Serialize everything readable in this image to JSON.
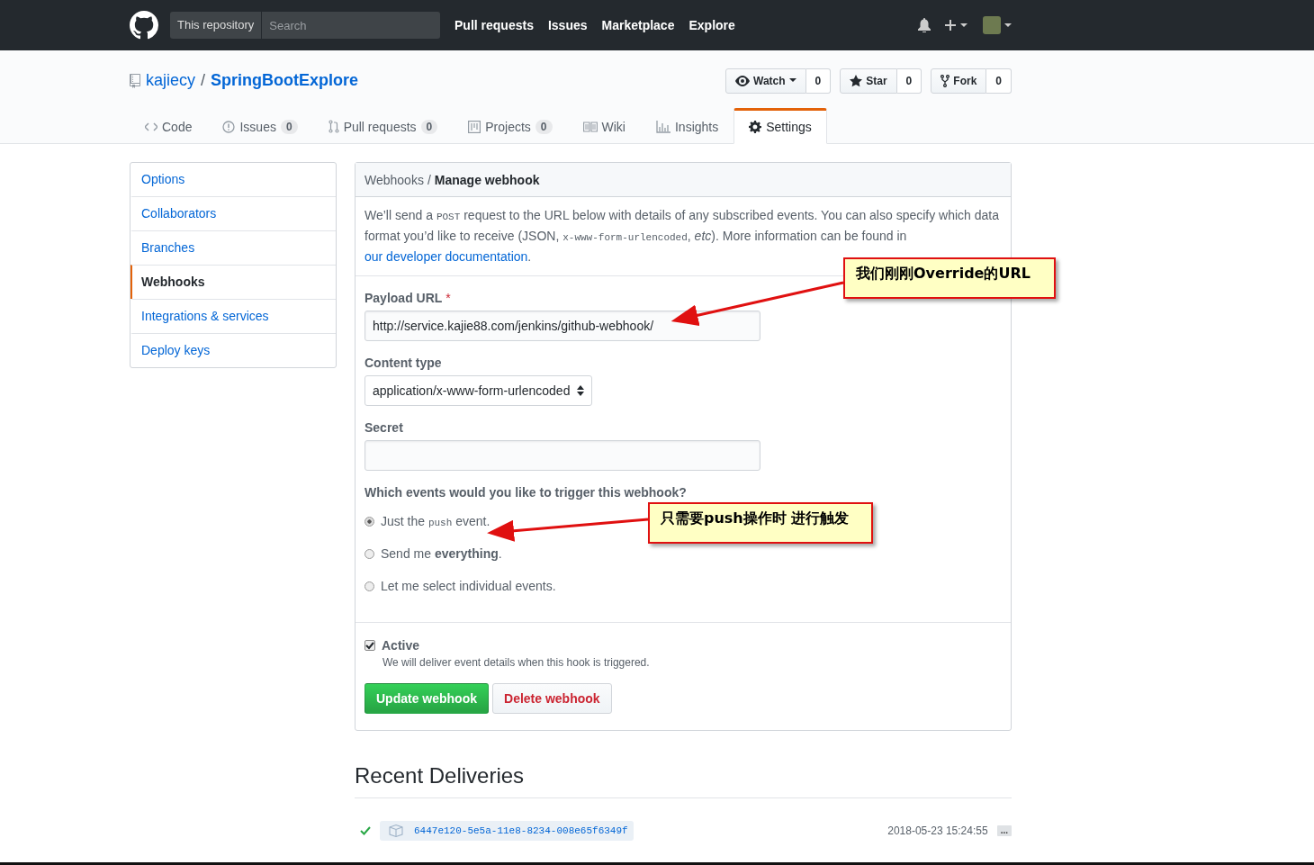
{
  "header": {
    "scope": "This repository",
    "search_placeholder": "Search",
    "nav": [
      "Pull requests",
      "Issues",
      "Marketplace",
      "Explore"
    ]
  },
  "repo": {
    "owner": "kajiecy",
    "separator": "/",
    "name": "SpringBootExplore"
  },
  "repo_actions": [
    {
      "kind": "watch",
      "label": "Watch",
      "count": "0"
    },
    {
      "kind": "star",
      "label": "Star",
      "count": "0"
    },
    {
      "kind": "fork",
      "label": "Fork",
      "count": "0"
    }
  ],
  "tabs": [
    {
      "kind": "code",
      "label": "Code",
      "selected": false
    },
    {
      "kind": "issues",
      "label": "Issues",
      "count": "0",
      "selected": false
    },
    {
      "kind": "pulls",
      "label": "Pull requests",
      "count": "0",
      "selected": false
    },
    {
      "kind": "projects",
      "label": "Projects",
      "count": "0",
      "selected": false
    },
    {
      "kind": "wiki",
      "label": "Wiki",
      "selected": false
    },
    {
      "kind": "insights",
      "label": "Insights",
      "selected": false
    },
    {
      "kind": "settings",
      "label": "Settings",
      "selected": true
    }
  ],
  "sidebar": {
    "items": [
      {
        "label": "Options",
        "selected": false
      },
      {
        "label": "Collaborators",
        "selected": false
      },
      {
        "label": "Branches",
        "selected": false
      },
      {
        "label": "Webhooks",
        "selected": true
      },
      {
        "label": "Integrations & services",
        "selected": false
      },
      {
        "label": "Deploy keys",
        "selected": false
      }
    ]
  },
  "breadcrumb": {
    "parent": "Webhooks",
    "separator": "/",
    "current": "Manage webhook"
  },
  "intro": [
    {
      "kind": "text",
      "text": "We’ll send a "
    },
    {
      "kind": "code",
      "text": "POST"
    },
    {
      "kind": "text",
      "text": " request to the URL below with details of any subscribed events. You can also specify which data format you’d like to receive (JSON, "
    },
    {
      "kind": "code",
      "text": "x-www-form-urlencoded"
    },
    {
      "kind": "text",
      "text": ", "
    },
    {
      "kind": "em",
      "text": "etc"
    },
    {
      "kind": "text",
      "text": "). More information can be found in "
    },
    {
      "kind": "link",
      "text": "our developer documentation"
    },
    {
      "kind": "text",
      "text": "."
    }
  ],
  "fields": [
    {
      "kind": "text",
      "label": "Payload URL",
      "required_mark": "*",
      "value": "http://service.kajie88.com/jenkins/github-webhook/"
    },
    {
      "kind": "select",
      "label": "Content type",
      "value": "application/x-www-form-urlencoded"
    },
    {
      "kind": "text",
      "label": "Secret"
    }
  ],
  "events": {
    "question": "Which events would you like to trigger this webhook?",
    "options": [
      {
        "selected": true,
        "segments": [
          {
            "kind": "text",
            "text": "Just the "
          },
          {
            "kind": "code",
            "text": "push"
          },
          {
            "kind": "text",
            "text": " event."
          }
        ]
      },
      {
        "selected": false,
        "segments": [
          {
            "kind": "text",
            "text": "Send me "
          },
          {
            "kind": "bold",
            "text": "everything"
          },
          {
            "kind": "text",
            "text": "."
          }
        ]
      },
      {
        "selected": false,
        "segments": [
          {
            "kind": "text",
            "text": "Let me select individual events."
          }
        ]
      }
    ]
  },
  "active": {
    "label": "Active",
    "checked": true,
    "note": "We will deliver event details when this hook is triggered."
  },
  "buttons": [
    {
      "kind": "primary",
      "label": "Update webhook"
    },
    {
      "kind": "danger",
      "label": "Delete webhook"
    }
  ],
  "deliveries": {
    "title": "Recent Deliveries",
    "items": [
      {
        "guid": "6447e120-5e5a-11e8-8234-008e65f6349f",
        "date": "2018-05-23 15:24:55",
        "more": "..."
      }
    ]
  },
  "annotations": [
    {
      "text": "我们刚刚Override的URL"
    },
    {
      "text": "只需要push操作时 进行触发"
    }
  ]
}
